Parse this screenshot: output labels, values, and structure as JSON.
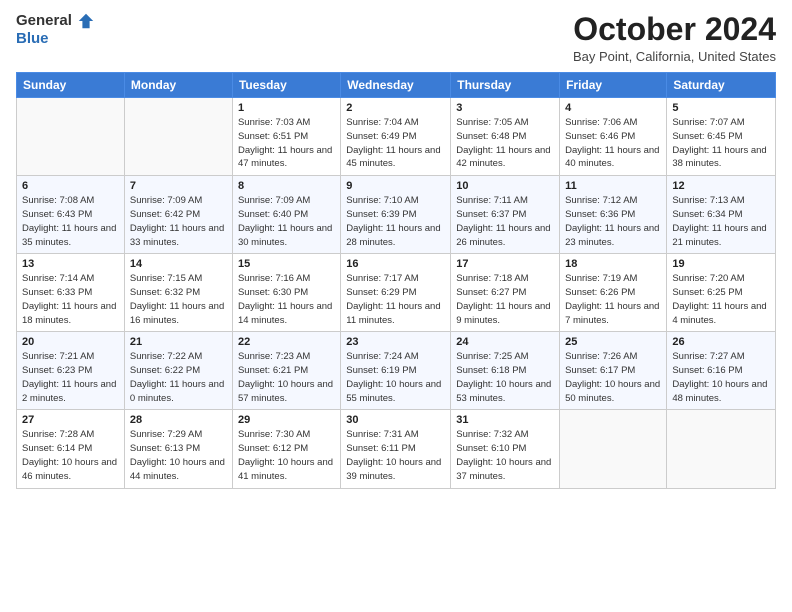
{
  "header": {
    "logo_line1": "General",
    "logo_line2": "Blue",
    "month": "October 2024",
    "location": "Bay Point, California, United States"
  },
  "days_of_week": [
    "Sunday",
    "Monday",
    "Tuesday",
    "Wednesday",
    "Thursday",
    "Friday",
    "Saturday"
  ],
  "weeks": [
    [
      {
        "day": "",
        "info": ""
      },
      {
        "day": "",
        "info": ""
      },
      {
        "day": "1",
        "info": "Sunrise: 7:03 AM\nSunset: 6:51 PM\nDaylight: 11 hours and 47 minutes."
      },
      {
        "day": "2",
        "info": "Sunrise: 7:04 AM\nSunset: 6:49 PM\nDaylight: 11 hours and 45 minutes."
      },
      {
        "day": "3",
        "info": "Sunrise: 7:05 AM\nSunset: 6:48 PM\nDaylight: 11 hours and 42 minutes."
      },
      {
        "day": "4",
        "info": "Sunrise: 7:06 AM\nSunset: 6:46 PM\nDaylight: 11 hours and 40 minutes."
      },
      {
        "day": "5",
        "info": "Sunrise: 7:07 AM\nSunset: 6:45 PM\nDaylight: 11 hours and 38 minutes."
      }
    ],
    [
      {
        "day": "6",
        "info": "Sunrise: 7:08 AM\nSunset: 6:43 PM\nDaylight: 11 hours and 35 minutes."
      },
      {
        "day": "7",
        "info": "Sunrise: 7:09 AM\nSunset: 6:42 PM\nDaylight: 11 hours and 33 minutes."
      },
      {
        "day": "8",
        "info": "Sunrise: 7:09 AM\nSunset: 6:40 PM\nDaylight: 11 hours and 30 minutes."
      },
      {
        "day": "9",
        "info": "Sunrise: 7:10 AM\nSunset: 6:39 PM\nDaylight: 11 hours and 28 minutes."
      },
      {
        "day": "10",
        "info": "Sunrise: 7:11 AM\nSunset: 6:37 PM\nDaylight: 11 hours and 26 minutes."
      },
      {
        "day": "11",
        "info": "Sunrise: 7:12 AM\nSunset: 6:36 PM\nDaylight: 11 hours and 23 minutes."
      },
      {
        "day": "12",
        "info": "Sunrise: 7:13 AM\nSunset: 6:34 PM\nDaylight: 11 hours and 21 minutes."
      }
    ],
    [
      {
        "day": "13",
        "info": "Sunrise: 7:14 AM\nSunset: 6:33 PM\nDaylight: 11 hours and 18 minutes."
      },
      {
        "day": "14",
        "info": "Sunrise: 7:15 AM\nSunset: 6:32 PM\nDaylight: 11 hours and 16 minutes."
      },
      {
        "day": "15",
        "info": "Sunrise: 7:16 AM\nSunset: 6:30 PM\nDaylight: 11 hours and 14 minutes."
      },
      {
        "day": "16",
        "info": "Sunrise: 7:17 AM\nSunset: 6:29 PM\nDaylight: 11 hours and 11 minutes."
      },
      {
        "day": "17",
        "info": "Sunrise: 7:18 AM\nSunset: 6:27 PM\nDaylight: 11 hours and 9 minutes."
      },
      {
        "day": "18",
        "info": "Sunrise: 7:19 AM\nSunset: 6:26 PM\nDaylight: 11 hours and 7 minutes."
      },
      {
        "day": "19",
        "info": "Sunrise: 7:20 AM\nSunset: 6:25 PM\nDaylight: 11 hours and 4 minutes."
      }
    ],
    [
      {
        "day": "20",
        "info": "Sunrise: 7:21 AM\nSunset: 6:23 PM\nDaylight: 11 hours and 2 minutes."
      },
      {
        "day": "21",
        "info": "Sunrise: 7:22 AM\nSunset: 6:22 PM\nDaylight: 11 hours and 0 minutes."
      },
      {
        "day": "22",
        "info": "Sunrise: 7:23 AM\nSunset: 6:21 PM\nDaylight: 10 hours and 57 minutes."
      },
      {
        "day": "23",
        "info": "Sunrise: 7:24 AM\nSunset: 6:19 PM\nDaylight: 10 hours and 55 minutes."
      },
      {
        "day": "24",
        "info": "Sunrise: 7:25 AM\nSunset: 6:18 PM\nDaylight: 10 hours and 53 minutes."
      },
      {
        "day": "25",
        "info": "Sunrise: 7:26 AM\nSunset: 6:17 PM\nDaylight: 10 hours and 50 minutes."
      },
      {
        "day": "26",
        "info": "Sunrise: 7:27 AM\nSunset: 6:16 PM\nDaylight: 10 hours and 48 minutes."
      }
    ],
    [
      {
        "day": "27",
        "info": "Sunrise: 7:28 AM\nSunset: 6:14 PM\nDaylight: 10 hours and 46 minutes."
      },
      {
        "day": "28",
        "info": "Sunrise: 7:29 AM\nSunset: 6:13 PM\nDaylight: 10 hours and 44 minutes."
      },
      {
        "day": "29",
        "info": "Sunrise: 7:30 AM\nSunset: 6:12 PM\nDaylight: 10 hours and 41 minutes."
      },
      {
        "day": "30",
        "info": "Sunrise: 7:31 AM\nSunset: 6:11 PM\nDaylight: 10 hours and 39 minutes."
      },
      {
        "day": "31",
        "info": "Sunrise: 7:32 AM\nSunset: 6:10 PM\nDaylight: 10 hours and 37 minutes."
      },
      {
        "day": "",
        "info": ""
      },
      {
        "day": "",
        "info": ""
      }
    ]
  ]
}
